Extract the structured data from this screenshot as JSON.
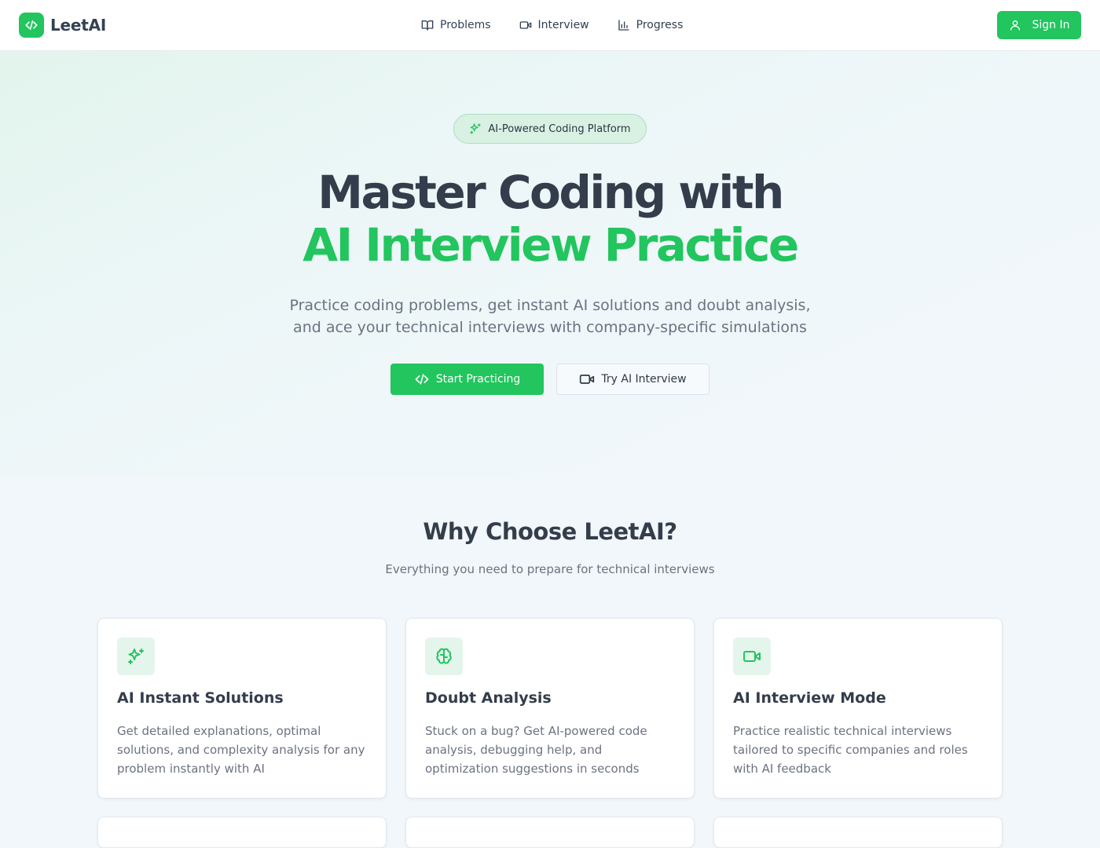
{
  "header": {
    "brand": "LeetAI",
    "nav": [
      {
        "label": "Problems",
        "icon": "book-icon"
      },
      {
        "label": "Interview",
        "icon": "video-icon"
      },
      {
        "label": "Progress",
        "icon": "bar-chart-icon"
      }
    ],
    "signin_label": "Sign In"
  },
  "hero": {
    "badge": "AI-Powered Coding Platform",
    "title_line1": "Master Coding with",
    "title_line2": "AI Interview Practice",
    "subtitle": "Practice coding problems, get instant AI solutions and doubt analysis, and ace your technical interviews with company-specific simulations",
    "primary_button": "Start Practicing",
    "secondary_button": "Try AI Interview"
  },
  "features": {
    "title": "Why Choose LeetAI?",
    "subtitle": "Everything you need to prepare for technical interviews",
    "cards": [
      {
        "icon": "sparkles-icon",
        "title": "AI Instant Solutions",
        "text": "Get detailed explanations, optimal solutions, and complexity analysis for any problem instantly with AI"
      },
      {
        "icon": "brain-icon",
        "title": "Doubt Analysis",
        "text": "Stuck on a bug? Get AI-powered code analysis, debugging help, and optimization suggestions in seconds"
      },
      {
        "icon": "video-icon",
        "title": "AI Interview Mode",
        "text": "Practice realistic technical interviews tailored to specific companies and roles with AI feedback"
      }
    ]
  },
  "colors": {
    "accent": "#22c55e",
    "heading": "#333d4b",
    "muted": "#6b7280"
  }
}
